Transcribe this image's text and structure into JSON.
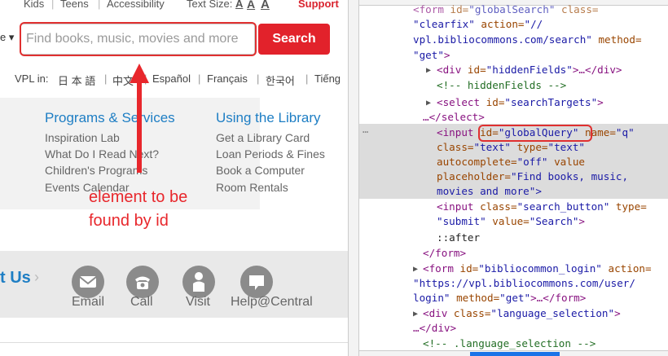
{
  "site": {
    "topnav": {
      "kids": "Kids",
      "teens": "Teens",
      "accessibility": "Accessibility",
      "text_size_label": "Text Size:",
      "text_size_options": [
        "A",
        "A",
        "A"
      ],
      "support": "Support"
    },
    "search": {
      "scope_fragment": "e ▾",
      "placeholder": "Find books, music, movies and more",
      "button_label": "Search"
    },
    "languages": {
      "label": "VPL in:",
      "items": [
        "日 本 語",
        "中文",
        "Español",
        "Français",
        "한국어",
        "Tiếng"
      ]
    },
    "columns": [
      {
        "heading": "Programs & Services",
        "links": [
          "Inspiration Lab",
          "What Do I Read Next?",
          "Children's Programs",
          "Events Calendar"
        ]
      },
      {
        "heading": "Using the Library",
        "links": [
          "Get a Library Card",
          "Loan Periods & Fines",
          "Book a Computer",
          "Room Rentals"
        ]
      }
    ],
    "contact": {
      "title": "t Us",
      "items": [
        {
          "label": "Email",
          "icon": "email-icon"
        },
        {
          "label": "Call",
          "icon": "phone-icon"
        },
        {
          "label": "Visit",
          "icon": "person-icon"
        },
        {
          "label": "Help@Central",
          "icon": "chat-icon"
        }
      ]
    },
    "annotation": "element to be\nfound by id"
  },
  "devtools": {
    "lines": {
      "l0_a": "<form ",
      "l0_b": "id=",
      "l0_c": "\"globalSearch\"",
      "l0_d": " class=",
      "l1": "\"clearfix\"",
      "l1_b": " action=",
      "l1_c": "\"//",
      "l2": "vpl.bibliocommons.com/search\"",
      "l2_b": " method=",
      "l3": "\"get\"",
      "l3_b": ">",
      "l4_a": "<div ",
      "l4_b": "id=",
      "l4_c": "\"hiddenFields\"",
      "l4_d": ">…</div>",
      "l5": "<!-- hiddenFields -->",
      "l6_a": "<select ",
      "l6_b": "id=",
      "l6_c": "\"searchTargets\"",
      "l6_d": ">",
      "l7": "…</select>",
      "l8_a": "<input ",
      "l8_b": "id=",
      "l8_c": "\"globalQuery\"",
      "l8_d": " name=",
      "l8_e": "\"q\"",
      "l9_a": "class=",
      "l9_b": "\"text\"",
      "l9_c": " type=",
      "l9_d": "\"text\"",
      "l10_a": "autocomplete=",
      "l10_b": "\"off\"",
      "l10_c": " value",
      "l11_a": "placeholder=",
      "l11_b": "\"Find books, music,",
      "l12": "movies and more\">",
      "l13_a": "<input ",
      "l13_b": "class=",
      "l13_c": "\"search_button\"",
      "l13_d": " type=",
      "l14": "\"submit\"",
      "l14_b": " value=",
      "l14_c": "\"Search\"",
      "l14_d": ">",
      "l15": "::after",
      "l16": "</form>",
      "l17_a": "<form ",
      "l17_b": "id=",
      "l17_c": "\"bibliocommon_login\"",
      "l17_d": " action=",
      "l18": "\"https://vpl.bibliocommons.com/user/",
      "l19": "login\"",
      "l19_b": " method=",
      "l19_c": "\"get\"",
      "l19_d": ">…</form>",
      "l20_a": "<div ",
      "l20_b": "class=",
      "l20_c": "\"language_selection\"",
      "l20_d": ">",
      "l21": "…</div>",
      "l22": "<!-- .language_selection -->"
    },
    "selected_dots": "…"
  },
  "colors": {
    "accent_red": "#e2222b",
    "link_blue": "#1e7ec4",
    "annotation_red": "#e8272c",
    "tag_purple": "#881280",
    "attr_brown": "#994500",
    "value_blue": "#1a1aa6",
    "comment_green": "#236e25"
  }
}
